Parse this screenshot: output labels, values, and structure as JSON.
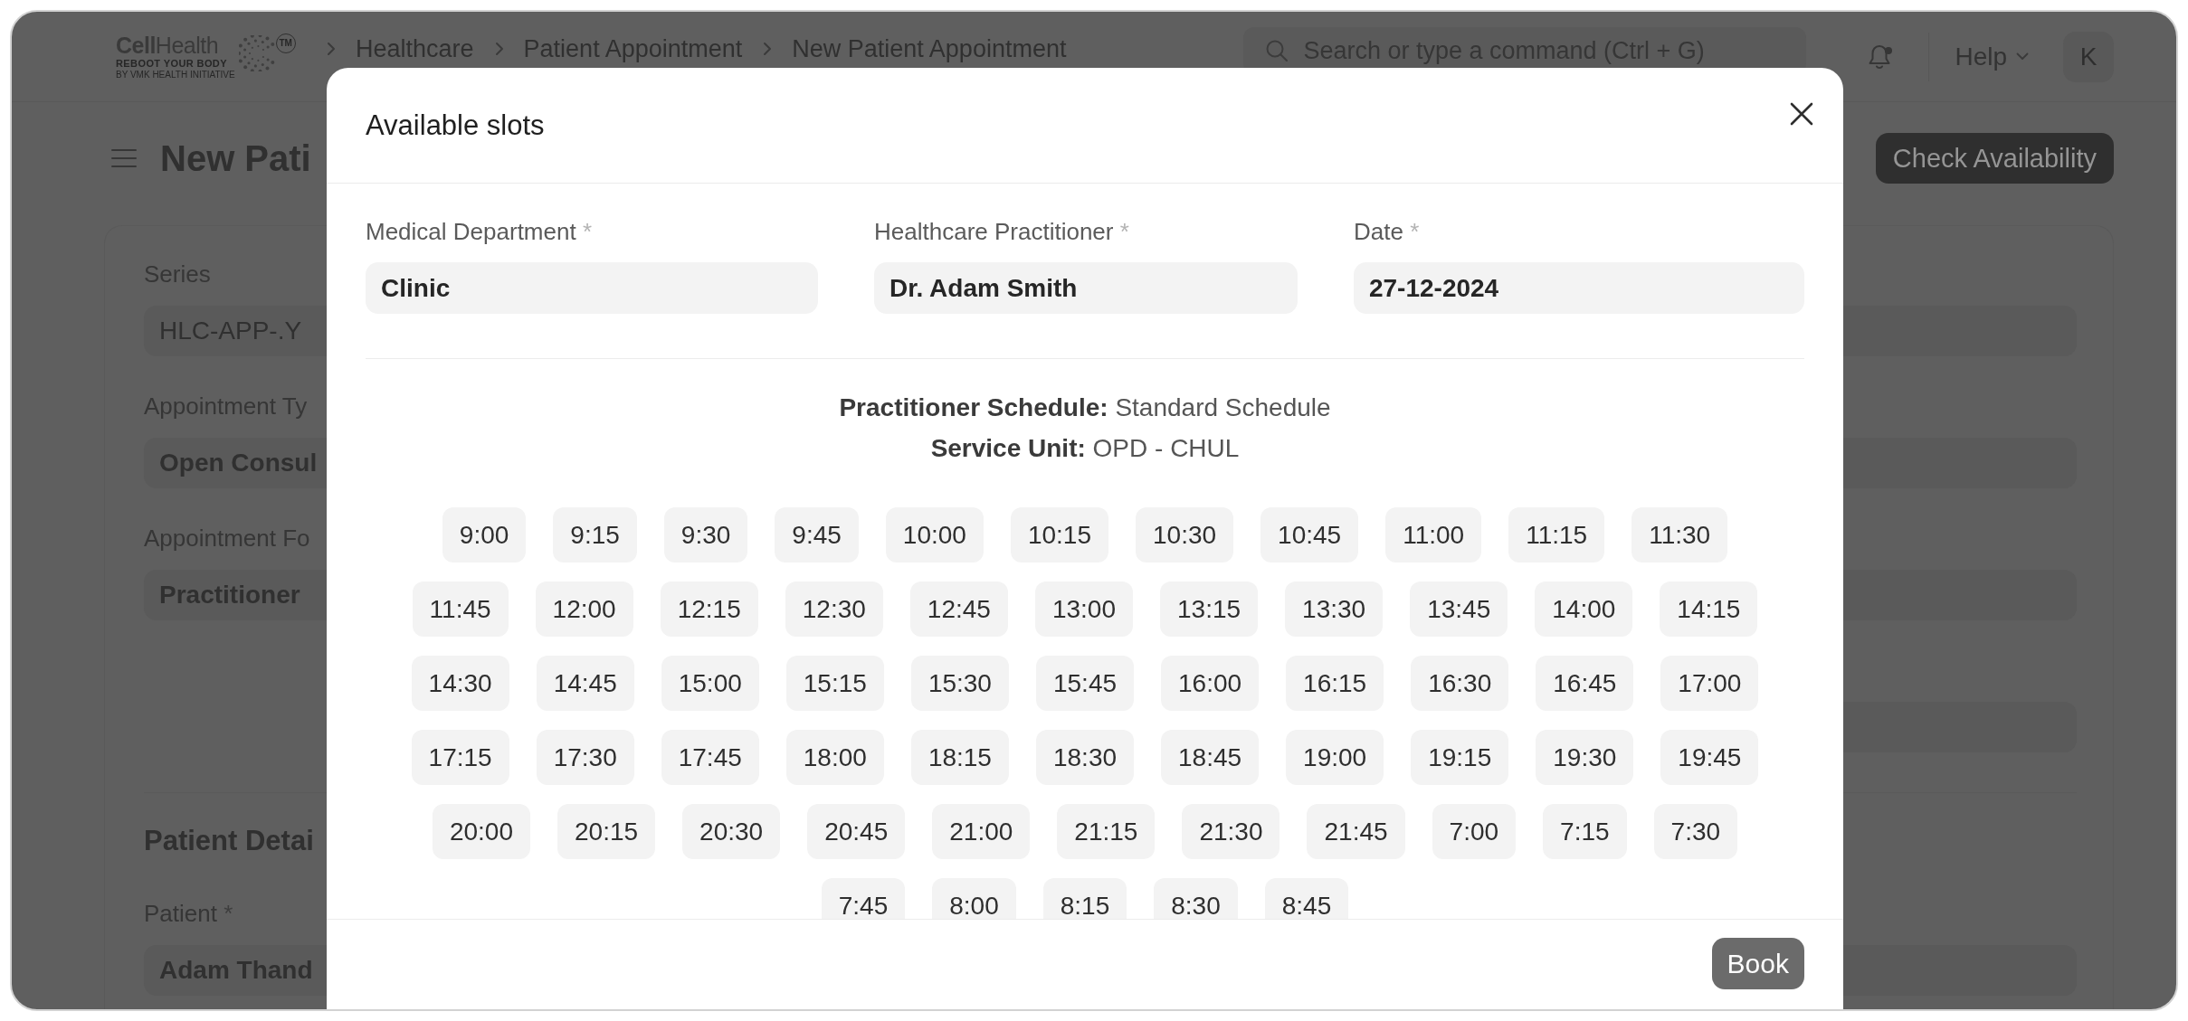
{
  "navbar": {
    "logo": {
      "wordmark": "**Cell**Health",
      "tagline": "REBOOT YOUR BODY",
      "subline": "BY VMK HEALTH INITIATIVE",
      "trademark": "TM"
    },
    "breadcrumbs": [
      "Healthcare",
      "Patient Appointment",
      "New Patient Appointment"
    ],
    "search": {
      "placeholder": "Search or type a command (Ctrl + G)"
    },
    "notifications": {
      "unread": true
    },
    "help": "Help",
    "avatar": "K"
  },
  "page": {
    "title": "New Pati",
    "primary_action": "Check Availability",
    "form": {
      "fields": [
        {
          "label": "Series",
          "kind": "select",
          "value": "HLC-APP-.Y"
        },
        {
          "label": "Appointment Ty",
          "kind": "link",
          "value": "Open Consul"
        },
        {
          "label": "Appointment Fo",
          "kind": "link",
          "value": "Practitioner"
        }
      ],
      "sections": [
        {
          "title": "Patient Detai",
          "fields": [
            {
              "label": "Patient",
              "required_mark": "*",
              "kind": "link",
              "value": "Adam Thand"
            }
          ]
        }
      ]
    }
  },
  "modal": {
    "title": "Available slots",
    "fields": [
      {
        "label": "Medical Department",
        "required_mark": "*",
        "value": "Clinic"
      },
      {
        "label": "Healthcare Practitioner",
        "required_mark": "*",
        "value": "Dr. Adam Smith"
      },
      {
        "label": "Date",
        "required_mark": "*",
        "value": "27-12-2024"
      }
    ],
    "schedule": [
      "**Practitioner Schedule:** Standard Schedule",
      "**Service Unit:** OPD - CHUL"
    ],
    "slots": [
      {
        "time": "9:00",
        "selected": false
      },
      {
        "time": "9:15",
        "selected": false
      },
      {
        "time": "9:30",
        "selected": false
      },
      {
        "time": "9:45",
        "selected": false
      },
      {
        "time": "10:00",
        "selected": false
      },
      {
        "time": "10:15",
        "selected": false
      },
      {
        "time": "10:30",
        "selected": false
      },
      {
        "time": "10:45",
        "selected": false
      },
      {
        "time": "11:00",
        "selected": false
      },
      {
        "time": "11:15",
        "selected": false
      },
      {
        "time": "11:30",
        "selected": false
      },
      {
        "time": "11:45",
        "selected": false
      },
      {
        "time": "12:00",
        "selected": false
      },
      {
        "time": "12:15",
        "selected": false
      },
      {
        "time": "12:30",
        "selected": false
      },
      {
        "time": "12:45",
        "selected": false
      },
      {
        "time": "13:00",
        "selected": false
      },
      {
        "time": "13:15",
        "selected": false
      },
      {
        "time": "13:30",
        "selected": false
      },
      {
        "time": "13:45",
        "selected": false
      },
      {
        "time": "14:00",
        "selected": false
      },
      {
        "time": "14:15",
        "selected": false
      },
      {
        "time": "14:30",
        "selected": false
      },
      {
        "time": "14:45",
        "selected": false
      },
      {
        "time": "15:00",
        "selected": false
      },
      {
        "time": "15:15",
        "selected": false
      },
      {
        "time": "15:30",
        "selected": false
      },
      {
        "time": "15:45",
        "selected": false
      },
      {
        "time": "16:00",
        "selected": false
      },
      {
        "time": "16:15",
        "selected": false
      },
      {
        "time": "16:30",
        "selected": false
      },
      {
        "time": "16:45",
        "selected": false
      },
      {
        "time": "17:00",
        "selected": false
      },
      {
        "time": "17:15",
        "selected": false
      },
      {
        "time": "17:30",
        "selected": false
      },
      {
        "time": "17:45",
        "selected": false
      },
      {
        "time": "18:00",
        "selected": false
      },
      {
        "time": "18:15",
        "selected": false
      },
      {
        "time": "18:30",
        "selected": false
      },
      {
        "time": "18:45",
        "selected": false
      },
      {
        "time": "19:00",
        "selected": false
      },
      {
        "time": "19:15",
        "selected": false
      },
      {
        "time": "19:30",
        "selected": false
      },
      {
        "time": "19:45",
        "selected": false
      },
      {
        "time": "20:00",
        "selected": false
      },
      {
        "time": "20:15",
        "selected": false
      },
      {
        "time": "20:30",
        "selected": false
      },
      {
        "time": "20:45",
        "selected": false
      },
      {
        "time": "21:00",
        "selected": false
      },
      {
        "time": "21:15",
        "selected": false
      },
      {
        "time": "21:30",
        "selected": false
      },
      {
        "time": "21:45",
        "selected": false
      },
      {
        "time": "7:00",
        "selected": false
      },
      {
        "time": "7:15",
        "selected": false
      },
      {
        "time": "7:30",
        "selected": false
      },
      {
        "time": "7:45",
        "selected": false
      },
      {
        "time": "8:00",
        "selected": false
      },
      {
        "time": "8:15",
        "selected": false
      },
      {
        "time": "8:30",
        "selected": false
      },
      {
        "time": "8:45",
        "selected": false
      }
    ],
    "book_button": "Book"
  }
}
